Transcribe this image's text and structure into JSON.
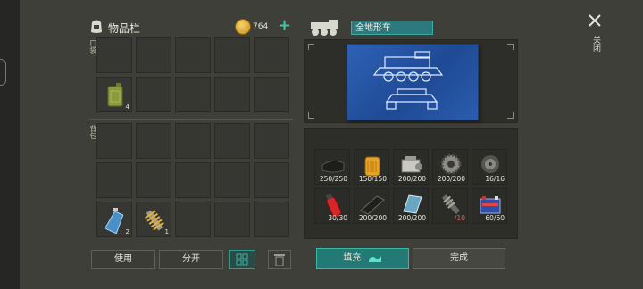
{
  "inventory": {
    "title": "物品栏",
    "pocket_label": "口袋",
    "backpack_label": "背包",
    "pocket_items": [
      {
        "icon": "fuel-canister-icon",
        "count": "4"
      }
    ],
    "backpack_items": [
      {
        "icon": "water-bottle-icon",
        "count": "2"
      },
      {
        "icon": "spring-shock-icon",
        "count": "1"
      }
    ]
  },
  "currency": {
    "value": "764",
    "add_label": "+"
  },
  "vehicle": {
    "name": "全地形车"
  },
  "materials": [
    {
      "icon": "rubber-sheet-icon",
      "count": "250/250"
    },
    {
      "icon": "oil-filter-icon",
      "count": "150/150"
    },
    {
      "icon": "engine-block-icon",
      "count": "200/200"
    },
    {
      "icon": "gear-icon",
      "count": "200/200"
    },
    {
      "icon": "wheel-hub-icon",
      "count": "16/16"
    },
    {
      "icon": "fire-extinguisher-icon",
      "count": "30/30"
    },
    {
      "icon": "metal-plate-icon",
      "count": "200/200"
    },
    {
      "icon": "glass-pane-icon",
      "count": "200/200"
    },
    {
      "icon": "drive-shaft-icon",
      "count": "/10"
    },
    {
      "icon": "battery-icon",
      "count": "60/60"
    }
  ],
  "buttons": {
    "use": "使用",
    "split": "分开",
    "fill": "填充",
    "done": "完成",
    "close": "关闭"
  },
  "colors": {
    "accent": "#3ab7a5",
    "blueprint": "#2b5cb0"
  }
}
